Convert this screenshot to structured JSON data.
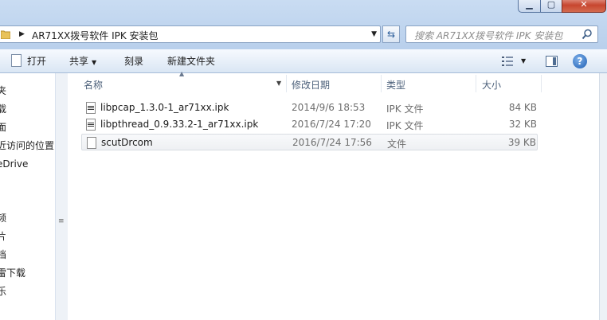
{
  "window": {
    "minimize_icon": "minimize-icon",
    "maximize_icon": "maximize-icon",
    "close_icon": "close-icon"
  },
  "address": {
    "crumb": "AR71XX拨号软件 IPK 安装包",
    "refresh_icon": "refresh-icon"
  },
  "search": {
    "placeholder": "搜索 AR71XX拨号软件 IPK 安装包"
  },
  "toolbar": {
    "open": "打开",
    "share": "共享",
    "burn": "刻录",
    "new_folder": "新建文件夹"
  },
  "nav": {
    "items": [
      "夹",
      "载",
      "面",
      "近访问的位置",
      "eDrive",
      "频",
      "片",
      "档",
      "雷下载",
      "乐"
    ]
  },
  "columns": {
    "name": "名称",
    "date": "修改日期",
    "type": "类型",
    "size": "大小"
  },
  "files": [
    {
      "name": "libpcap_1.3.0-1_ar71xx.ipk",
      "date": "2014/9/6 18:53",
      "type": "IPK 文件",
      "size": "84 KB",
      "icon": "ipk-file-icon"
    },
    {
      "name": "libpthread_0.9.33.2-1_ar71xx.ipk",
      "date": "2016/7/24 17:20",
      "type": "IPK 文件",
      "size": "32 KB",
      "icon": "ipk-file-icon"
    },
    {
      "name": "scutDrcom",
      "date": "2016/7/24 17:56",
      "type": "文件",
      "size": "39 KB",
      "icon": "file-icon"
    }
  ],
  "colors": {
    "window_frame": "#b9d0ec",
    "close_button": "#c7462f",
    "hover_row": "#eef0f3"
  }
}
